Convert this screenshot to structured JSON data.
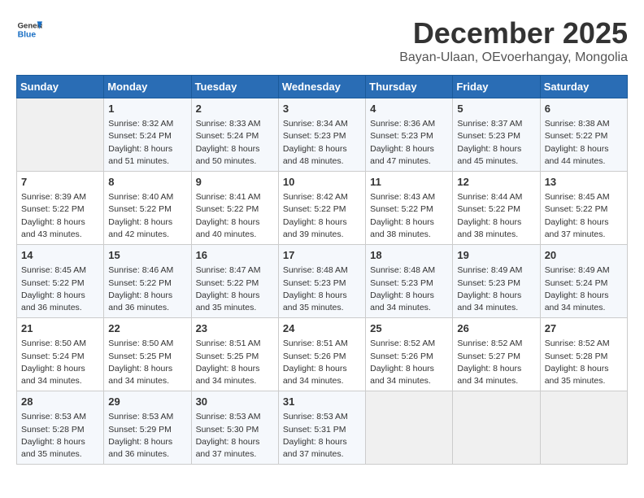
{
  "logo": {
    "general": "General",
    "blue": "Blue"
  },
  "title": "December 2025",
  "subtitle": "Bayan-Ulaan, OEvoerhangay, Mongolia",
  "days_header": [
    "Sunday",
    "Monday",
    "Tuesday",
    "Wednesday",
    "Thursday",
    "Friday",
    "Saturday"
  ],
  "weeks": [
    [
      {
        "day": "",
        "info": ""
      },
      {
        "day": "1",
        "info": "Sunrise: 8:32 AM\nSunset: 5:24 PM\nDaylight: 8 hours\nand 51 minutes."
      },
      {
        "day": "2",
        "info": "Sunrise: 8:33 AM\nSunset: 5:24 PM\nDaylight: 8 hours\nand 50 minutes."
      },
      {
        "day": "3",
        "info": "Sunrise: 8:34 AM\nSunset: 5:23 PM\nDaylight: 8 hours\nand 48 minutes."
      },
      {
        "day": "4",
        "info": "Sunrise: 8:36 AM\nSunset: 5:23 PM\nDaylight: 8 hours\nand 47 minutes."
      },
      {
        "day": "5",
        "info": "Sunrise: 8:37 AM\nSunset: 5:23 PM\nDaylight: 8 hours\nand 45 minutes."
      },
      {
        "day": "6",
        "info": "Sunrise: 8:38 AM\nSunset: 5:22 PM\nDaylight: 8 hours\nand 44 minutes."
      }
    ],
    [
      {
        "day": "7",
        "info": "Sunrise: 8:39 AM\nSunset: 5:22 PM\nDaylight: 8 hours\nand 43 minutes."
      },
      {
        "day": "8",
        "info": "Sunrise: 8:40 AM\nSunset: 5:22 PM\nDaylight: 8 hours\nand 42 minutes."
      },
      {
        "day": "9",
        "info": "Sunrise: 8:41 AM\nSunset: 5:22 PM\nDaylight: 8 hours\nand 40 minutes."
      },
      {
        "day": "10",
        "info": "Sunrise: 8:42 AM\nSunset: 5:22 PM\nDaylight: 8 hours\nand 39 minutes."
      },
      {
        "day": "11",
        "info": "Sunrise: 8:43 AM\nSunset: 5:22 PM\nDaylight: 8 hours\nand 38 minutes."
      },
      {
        "day": "12",
        "info": "Sunrise: 8:44 AM\nSunset: 5:22 PM\nDaylight: 8 hours\nand 38 minutes."
      },
      {
        "day": "13",
        "info": "Sunrise: 8:45 AM\nSunset: 5:22 PM\nDaylight: 8 hours\nand 37 minutes."
      }
    ],
    [
      {
        "day": "14",
        "info": "Sunrise: 8:45 AM\nSunset: 5:22 PM\nDaylight: 8 hours\nand 36 minutes."
      },
      {
        "day": "15",
        "info": "Sunrise: 8:46 AM\nSunset: 5:22 PM\nDaylight: 8 hours\nand 36 minutes."
      },
      {
        "day": "16",
        "info": "Sunrise: 8:47 AM\nSunset: 5:22 PM\nDaylight: 8 hours\nand 35 minutes."
      },
      {
        "day": "17",
        "info": "Sunrise: 8:48 AM\nSunset: 5:23 PM\nDaylight: 8 hours\nand 35 minutes."
      },
      {
        "day": "18",
        "info": "Sunrise: 8:48 AM\nSunset: 5:23 PM\nDaylight: 8 hours\nand 34 minutes."
      },
      {
        "day": "19",
        "info": "Sunrise: 8:49 AM\nSunset: 5:23 PM\nDaylight: 8 hours\nand 34 minutes."
      },
      {
        "day": "20",
        "info": "Sunrise: 8:49 AM\nSunset: 5:24 PM\nDaylight: 8 hours\nand 34 minutes."
      }
    ],
    [
      {
        "day": "21",
        "info": "Sunrise: 8:50 AM\nSunset: 5:24 PM\nDaylight: 8 hours\nand 34 minutes."
      },
      {
        "day": "22",
        "info": "Sunrise: 8:50 AM\nSunset: 5:25 PM\nDaylight: 8 hours\nand 34 minutes."
      },
      {
        "day": "23",
        "info": "Sunrise: 8:51 AM\nSunset: 5:25 PM\nDaylight: 8 hours\nand 34 minutes."
      },
      {
        "day": "24",
        "info": "Sunrise: 8:51 AM\nSunset: 5:26 PM\nDaylight: 8 hours\nand 34 minutes."
      },
      {
        "day": "25",
        "info": "Sunrise: 8:52 AM\nSunset: 5:26 PM\nDaylight: 8 hours\nand 34 minutes."
      },
      {
        "day": "26",
        "info": "Sunrise: 8:52 AM\nSunset: 5:27 PM\nDaylight: 8 hours\nand 34 minutes."
      },
      {
        "day": "27",
        "info": "Sunrise: 8:52 AM\nSunset: 5:28 PM\nDaylight: 8 hours\nand 35 minutes."
      }
    ],
    [
      {
        "day": "28",
        "info": "Sunrise: 8:53 AM\nSunset: 5:28 PM\nDaylight: 8 hours\nand 35 minutes."
      },
      {
        "day": "29",
        "info": "Sunrise: 8:53 AM\nSunset: 5:29 PM\nDaylight: 8 hours\nand 36 minutes."
      },
      {
        "day": "30",
        "info": "Sunrise: 8:53 AM\nSunset: 5:30 PM\nDaylight: 8 hours\nand 37 minutes."
      },
      {
        "day": "31",
        "info": "Sunrise: 8:53 AM\nSunset: 5:31 PM\nDaylight: 8 hours\nand 37 minutes."
      },
      {
        "day": "",
        "info": ""
      },
      {
        "day": "",
        "info": ""
      },
      {
        "day": "",
        "info": ""
      }
    ]
  ]
}
